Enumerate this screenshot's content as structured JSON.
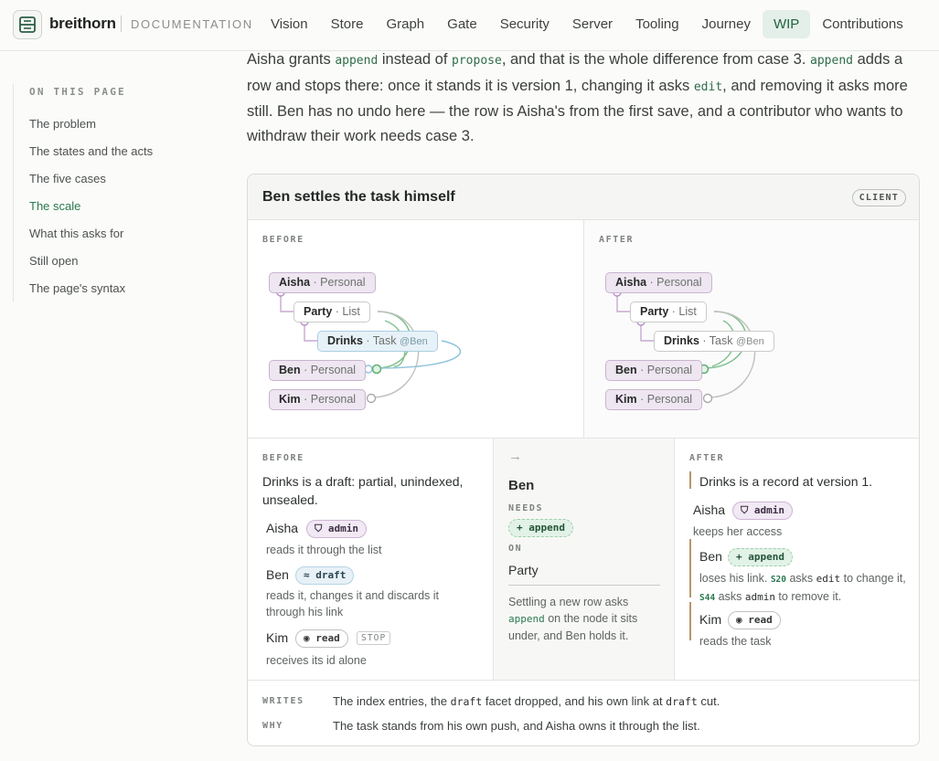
{
  "header": {
    "brand": "breithorn",
    "section": "DOCUMENTATION",
    "nav": [
      {
        "label": "Vision"
      },
      {
        "label": "Store"
      },
      {
        "label": "Graph"
      },
      {
        "label": "Gate"
      },
      {
        "label": "Security"
      },
      {
        "label": "Server"
      },
      {
        "label": "Tooling"
      },
      {
        "label": "Journey"
      },
      {
        "label": "WIP",
        "active": true
      },
      {
        "label": "Contributions"
      }
    ]
  },
  "sidebar": {
    "heading": "ON THIS PAGE",
    "items": [
      {
        "label": "The problem"
      },
      {
        "label": "The states and the acts"
      },
      {
        "label": "The five cases"
      },
      {
        "label": "The scale",
        "active": true
      },
      {
        "label": "What this asks for"
      },
      {
        "label": "Still open"
      },
      {
        "label": "The page's syntax"
      }
    ]
  },
  "intro": {
    "p1": "Aisha grants ",
    "c1": "append",
    "p2": " instead of ",
    "c2": "propose",
    "p3": ", and that is the whole difference from case 3. ",
    "c3": "append",
    "p4": " adds a row and stops there: once it stands it is version 1, changing it asks ",
    "c4": "edit",
    "p5": ", and removing it asks more still. Ben has no undo here — the row is Aisha's from the first save, and a contributor who wants to withdraw their work needs case 3."
  },
  "card": {
    "title": "Ben settles the task himself",
    "badge": "CLIENT",
    "graph_before_label": "BEFORE",
    "graph_after_label": "AFTER",
    "nodes": {
      "aisha": {
        "name": "Aisha",
        "kind": "· Personal"
      },
      "party": {
        "name": "Party",
        "kind": "· List"
      },
      "drinks": {
        "name": "Drinks",
        "kind": "· Task",
        "at": "@Ben"
      },
      "ben": {
        "name": "Ben",
        "kind": "· Personal"
      },
      "kim": {
        "name": "Kim",
        "kind": "· Personal"
      }
    },
    "before": {
      "label": "BEFORE",
      "state": "Drinks is a draft: partial, unindexed, unsealed.",
      "people": [
        {
          "name": "Aisha",
          "pill": "admin",
          "pill_icon": "shield-icon",
          "note": "reads it through the list"
        },
        {
          "name": "Ben",
          "pill": "draft",
          "pill_icon": "approx-icon",
          "note": "reads it, changes it and discards it through his link"
        },
        {
          "name": "Kim",
          "pill": "read",
          "pill_icon": "eye-icon",
          "stop": "STOP",
          "note": "receives its id alone"
        }
      ]
    },
    "act": {
      "arrow": "→",
      "actor": "Ben",
      "needs_label": "NEEDS",
      "needs": "+ append",
      "on_label": "ON",
      "on": "Party",
      "note_1": "Settling a new row asks",
      "note_code": "append",
      "note_2": " on the node it sits under, and Ben holds it."
    },
    "after": {
      "label": "AFTER",
      "state": "Drinks is a record at version 1.",
      "aisha": {
        "name": "Aisha",
        "pill": "admin",
        "note": "keeps her access"
      },
      "ben": {
        "name": "Ben",
        "pill": "+ append",
        "note_1": "loses his link. ",
        "s1": "S20",
        "note_2": " asks ",
        "c1": "edit",
        "note_3": " to change it, ",
        "s2": "S44",
        "note_4": " asks ",
        "c2": "admin",
        "note_5": " to remove it."
      },
      "kim": {
        "name": "Kim",
        "pill": "read",
        "note": "reads the task"
      }
    },
    "footer": {
      "writes_label": "WRITES",
      "writes_1": "The index entries, the ",
      "writes_c1": "draft",
      "writes_2": " facet dropped, and his own link at ",
      "writes_c2": "draft",
      "writes_3": " cut.",
      "why_label": "WHY",
      "why": "The task stands from his own push, and Aisha owns it through the list."
    }
  },
  "colors": {
    "accent": "#2b7a50",
    "personal_fill": "#eee6f1",
    "task_fill": "#e7f2f8",
    "after_bar": "#b8956c"
  }
}
